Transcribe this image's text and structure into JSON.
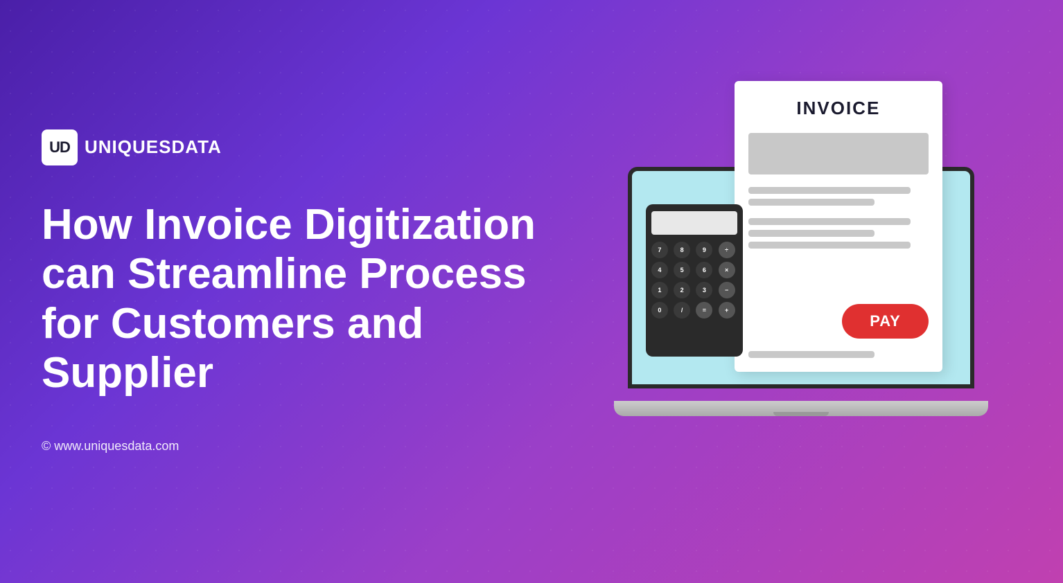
{
  "logo": {
    "icon_text": "UD",
    "brand_name": "UNIQUESDATA"
  },
  "hero": {
    "title": "How Invoice Digitization can Streamline Process for Customers and Supplier"
  },
  "invoice": {
    "title": "INVOICE",
    "pay_button": "PAY"
  },
  "footer": {
    "copyright": "© www.uniquesdata.com"
  },
  "colors": {
    "bg_start": "#4a1fa8",
    "bg_end": "#c040b0",
    "pay_red": "#e03030"
  },
  "calculator": {
    "buttons": [
      "7",
      "8",
      "9",
      "÷",
      "4",
      "5",
      "6",
      "×",
      "1",
      "2",
      "3",
      "−",
      "0",
      "/",
      "=",
      "+"
    ]
  }
}
